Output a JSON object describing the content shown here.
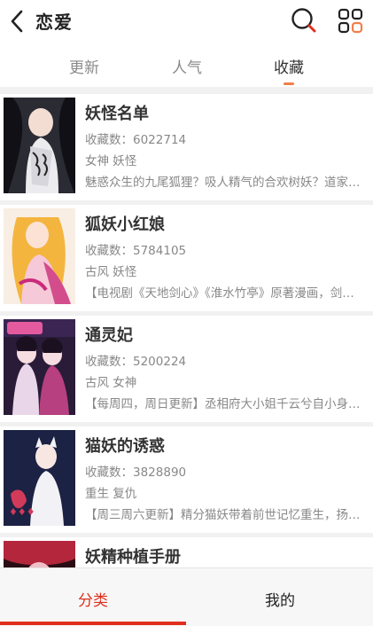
{
  "header": {
    "title": "恋爱"
  },
  "tabs": [
    {
      "label": "更新",
      "active": false
    },
    {
      "label": "人气",
      "active": false
    },
    {
      "label": "收藏",
      "active": true
    }
  ],
  "comics": [
    {
      "name": "妖怪名单",
      "count": "收藏数：6022714",
      "tags": "女神 妖怪",
      "desc": "魅惑众生的九尾狐狸？吸人精气的合欢树妖？道家…",
      "cover_colors": [
        "#3a3a42",
        "#e9e7ea",
        "#1a1a22"
      ]
    },
    {
      "name": "狐妖小红娘",
      "count": "收藏数：5784105",
      "tags": "古风 妖怪",
      "desc": "【电视剧《天地剑心》《淮水竹亭》原著漫画，剑…",
      "cover_colors": [
        "#f6e7d6",
        "#f2b23c",
        "#c9458a"
      ]
    },
    {
      "name": "通灵妃",
      "count": "收藏数：5200224",
      "tags": "古风 女神",
      "desc": "【每周四，周日更新】丞相府大小姐千云兮自小身…",
      "cover_colors": [
        "#2a1a3a",
        "#c94a8a",
        "#e8d5e6"
      ]
    },
    {
      "name": "猫妖的诱惑",
      "count": "收藏数：3828890",
      "tags": "重生 复仇",
      "desc": "【周三周六更新】精分猫妖带着前世记忆重生，扬…",
      "cover_colors": [
        "#1c2244",
        "#f2f2f6",
        "#d23a5a"
      ]
    },
    {
      "name": "妖精种植手册",
      "count": "",
      "tags": "",
      "desc": "",
      "cover_colors": [
        "#2a0d14",
        "#b3263c",
        "#f0c0c8"
      ]
    }
  ],
  "bottom_nav": [
    {
      "label": "分类",
      "active": true
    },
    {
      "label": "我的",
      "active": false
    }
  ],
  "colors": {
    "accent_red": "#e0301e",
    "tab_indicator": "#f07f4a",
    "grid_icon_orange": "#f07f4a"
  }
}
